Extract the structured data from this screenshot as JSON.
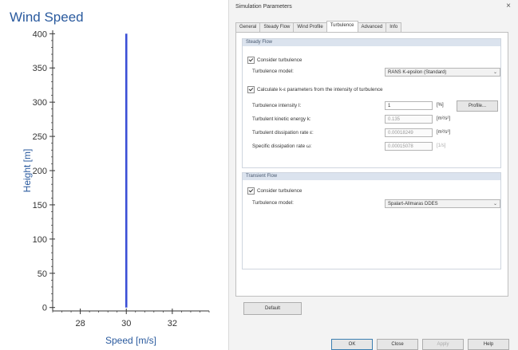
{
  "chart_data": {
    "type": "line",
    "title": "Wind Speed",
    "xlabel": "Speed [m/s]",
    "ylabel": "Height [m]",
    "xlim": [
      26.8,
      33.6
    ],
    "ylim": [
      -5,
      405
    ],
    "xticks": [
      28,
      30,
      32
    ],
    "yticks": [
      0,
      50,
      100,
      150,
      200,
      250,
      300,
      350,
      400
    ],
    "series": [
      {
        "x": [
          30,
          30
        ],
        "y": [
          0,
          400
        ],
        "color": "#3a4fd6"
      }
    ]
  },
  "dialog": {
    "title": "Simulation Parameters",
    "close_glyph": "×",
    "tabs": [
      "General",
      "Steady Flow",
      "Wind Profile",
      "Turbulence",
      "Advanced",
      "Info"
    ],
    "active_tab": "Turbulence",
    "steady": {
      "header": "Steady Flow",
      "consider_label": "Consider turbulence",
      "model_label": "Turbulence model:",
      "model_value": "RANS K-epsilon (Standard)",
      "calc_label": "Calculate k-ε parameters from the intensity of turbulence",
      "intensity_label": "Turbulence intensity I:",
      "intensity_value": "1",
      "intensity_unit": "[%]",
      "profile_button": "Profile...",
      "tke_label": "Turbulent kinetic energy k:",
      "tke_value": "0.135",
      "tke_unit": "[m²/s²]",
      "dissipation_label": "Turbulent dissipation rate ε:",
      "dissipation_value": "0.00018249",
      "dissipation_unit": "[m²/s³]",
      "specific_label": "Specific dissipation rate ω:",
      "specific_value": "0.00015078",
      "specific_unit": "[1/s]"
    },
    "transient": {
      "header": "Transient Flow",
      "consider_label": "Consider turbulence",
      "model_label": "Turbulence model:",
      "model_value": "Spalart-Allmaras DDES"
    },
    "default_button": "Default",
    "footer": {
      "ok": "OK",
      "close": "Close",
      "apply": "Apply",
      "help": "Help"
    }
  }
}
